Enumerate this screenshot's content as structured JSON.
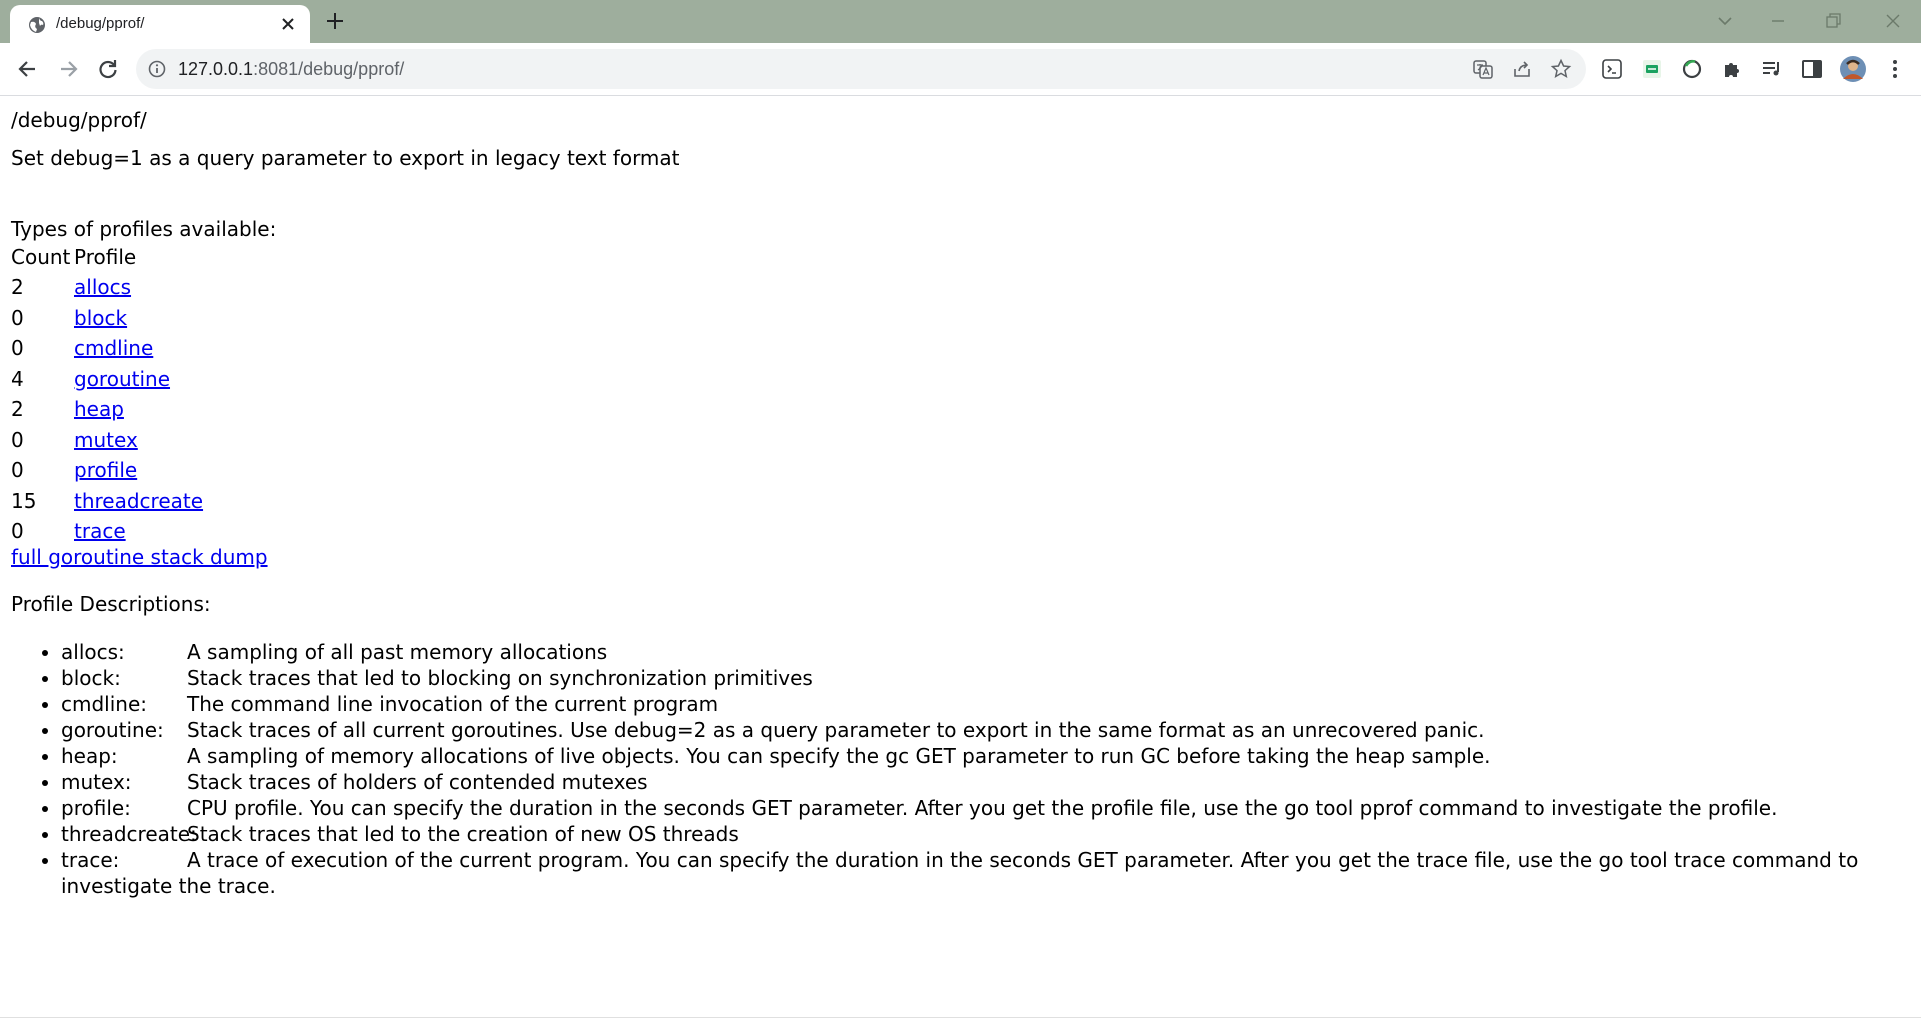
{
  "browser": {
    "tab_title": "/debug/pprof/",
    "url_host": "127.0.0.1",
    "url_rest": ":8081/debug/pprof/"
  },
  "page": {
    "title": "/debug/pprof/",
    "hint": "Set debug=1 as a query parameter to export in legacy text format",
    "types_label": "Types of profiles available:",
    "table_headers": {
      "count": "Count",
      "profile": "Profile"
    },
    "profiles": [
      {
        "count": "2",
        "name": "allocs"
      },
      {
        "count": "0",
        "name": "block"
      },
      {
        "count": "0",
        "name": "cmdline"
      },
      {
        "count": "4",
        "name": "goroutine"
      },
      {
        "count": "2",
        "name": "heap"
      },
      {
        "count": "0",
        "name": "mutex"
      },
      {
        "count": "0",
        "name": "profile"
      },
      {
        "count": "15",
        "name": "threadcreate"
      },
      {
        "count": "0",
        "name": "trace"
      }
    ],
    "full_dump_link": "full goroutine stack dump",
    "descriptions_label": "Profile Descriptions:",
    "descriptions": [
      {
        "name": "allocs:",
        "text": "A sampling of all past memory allocations"
      },
      {
        "name": "block:",
        "text": "Stack traces that led to blocking on synchronization primitives"
      },
      {
        "name": "cmdline:",
        "text": "The command line invocation of the current program"
      },
      {
        "name": "goroutine:",
        "text": "Stack traces of all current goroutines. Use debug=2 as a query parameter to export in the same format as an unrecovered panic."
      },
      {
        "name": "heap:",
        "text": "A sampling of memory allocations of live objects. You can specify the gc GET parameter to run GC before taking the heap sample."
      },
      {
        "name": "mutex:",
        "text": "Stack traces of holders of contended mutexes"
      },
      {
        "name": "profile:",
        "text": "CPU profile. You can specify the duration in the seconds GET parameter. After you get the profile file, use the go tool pprof command to investigate the profile."
      },
      {
        "name": "threadcreate:",
        "text": "Stack traces that led to the creation of new OS threads"
      },
      {
        "name": "trace:",
        "text": "A trace of execution of the current program. You can specify the duration in the seconds GET parameter. After you get the trace file, use the go tool trace command to investigate the trace."
      }
    ]
  }
}
